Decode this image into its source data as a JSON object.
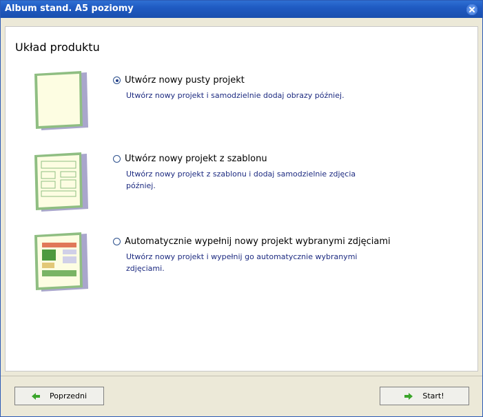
{
  "window": {
    "title": "Album stand. A5 poziomy"
  },
  "panel": {
    "title": "Układ produktu"
  },
  "options": [
    {
      "label": "Utwórz nowy pusty projekt",
      "description": "Utwórz nowy projekt i samodzielnie dodaj obrazy później.",
      "selected": true
    },
    {
      "label": "Utwórz nowy projekt z szablonu",
      "description": "Utwórz nowy projekt z szablonu i dodaj samodzielnie zdjęcia później.",
      "selected": false
    },
    {
      "label": "Automatycznie wypełnij nowy projekt wybranymi zdjęciami",
      "description": "Utwórz nowy projekt i wypełnij go automatycznie wybranymi zdjęciami.",
      "selected": false
    }
  ],
  "buttons": {
    "back_label": "Poprzedni",
    "start_label": "Start!"
  },
  "icons": {
    "close": "close-icon",
    "back": "arrow-left-icon",
    "start": "arrow-right-icon"
  },
  "colors": {
    "titlebar": "#1f5ac2",
    "description_text": "#1c2a80",
    "arrow_green": "#3aa52a"
  }
}
